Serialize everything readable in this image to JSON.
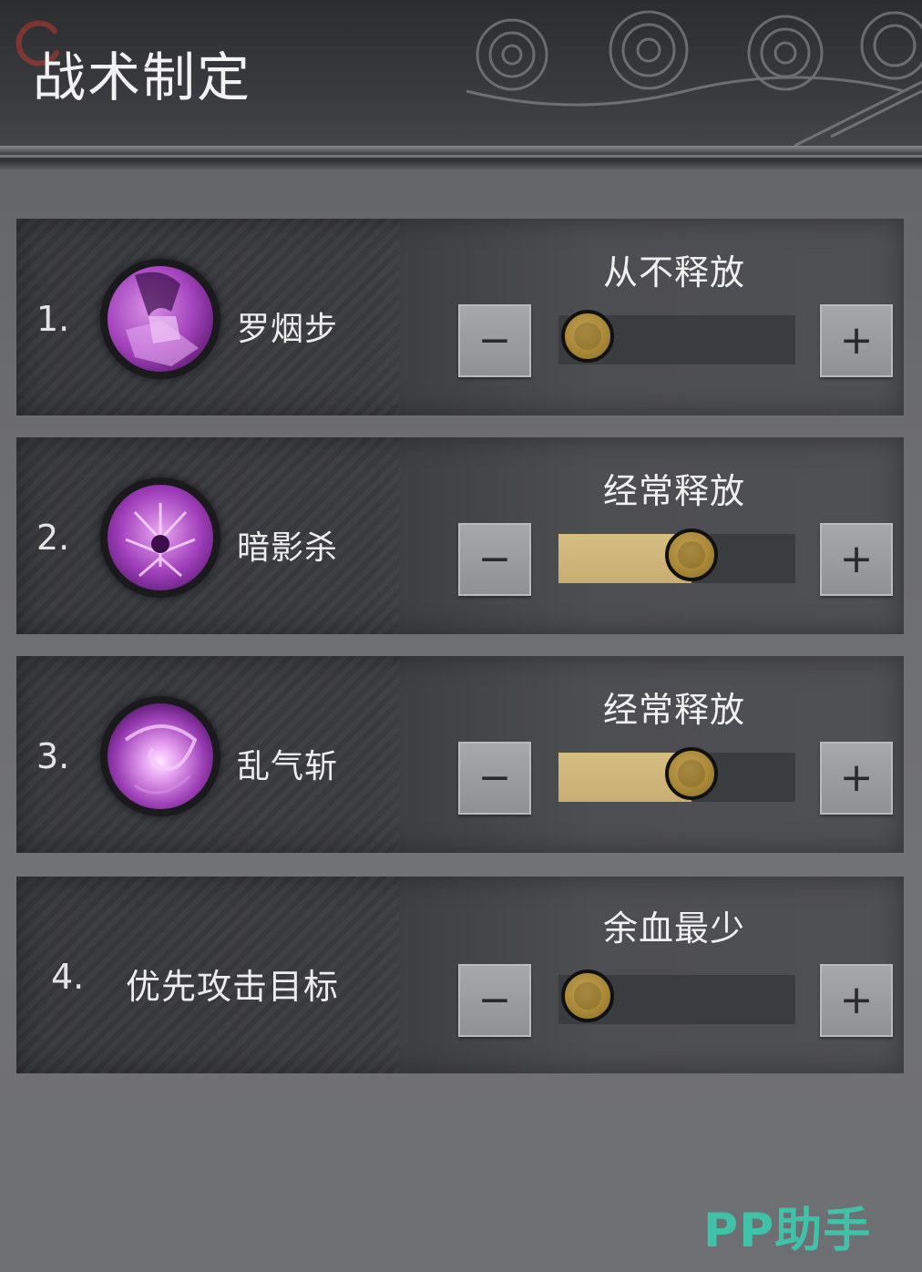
{
  "header": {
    "title": "战术制定"
  },
  "rows": [
    {
      "number": "1.",
      "skill": "罗烟步",
      "icon": "shadow-step-skill-icon",
      "setting": "从不释放",
      "level": 0
    },
    {
      "number": "2.",
      "skill": "暗影杀",
      "icon": "shadow-kill-skill-icon",
      "setting": "经常释放",
      "level": 0.5
    },
    {
      "number": "3.",
      "skill": "乱气斩",
      "icon": "chaos-slash-skill-icon",
      "setting": "经常释放",
      "level": 0.5
    },
    {
      "number": "4.",
      "skill": "优先攻击目标",
      "setting": "余血最少",
      "level": 0
    }
  ],
  "buttons": {
    "minus": "−",
    "plus": "+"
  },
  "watermark": "PP助手",
  "colors": {
    "slider_fill": "#d0b57a",
    "knob": "#b08f3e",
    "watermark": "#3fc2a8",
    "icon_purple": "#b04fc4"
  }
}
